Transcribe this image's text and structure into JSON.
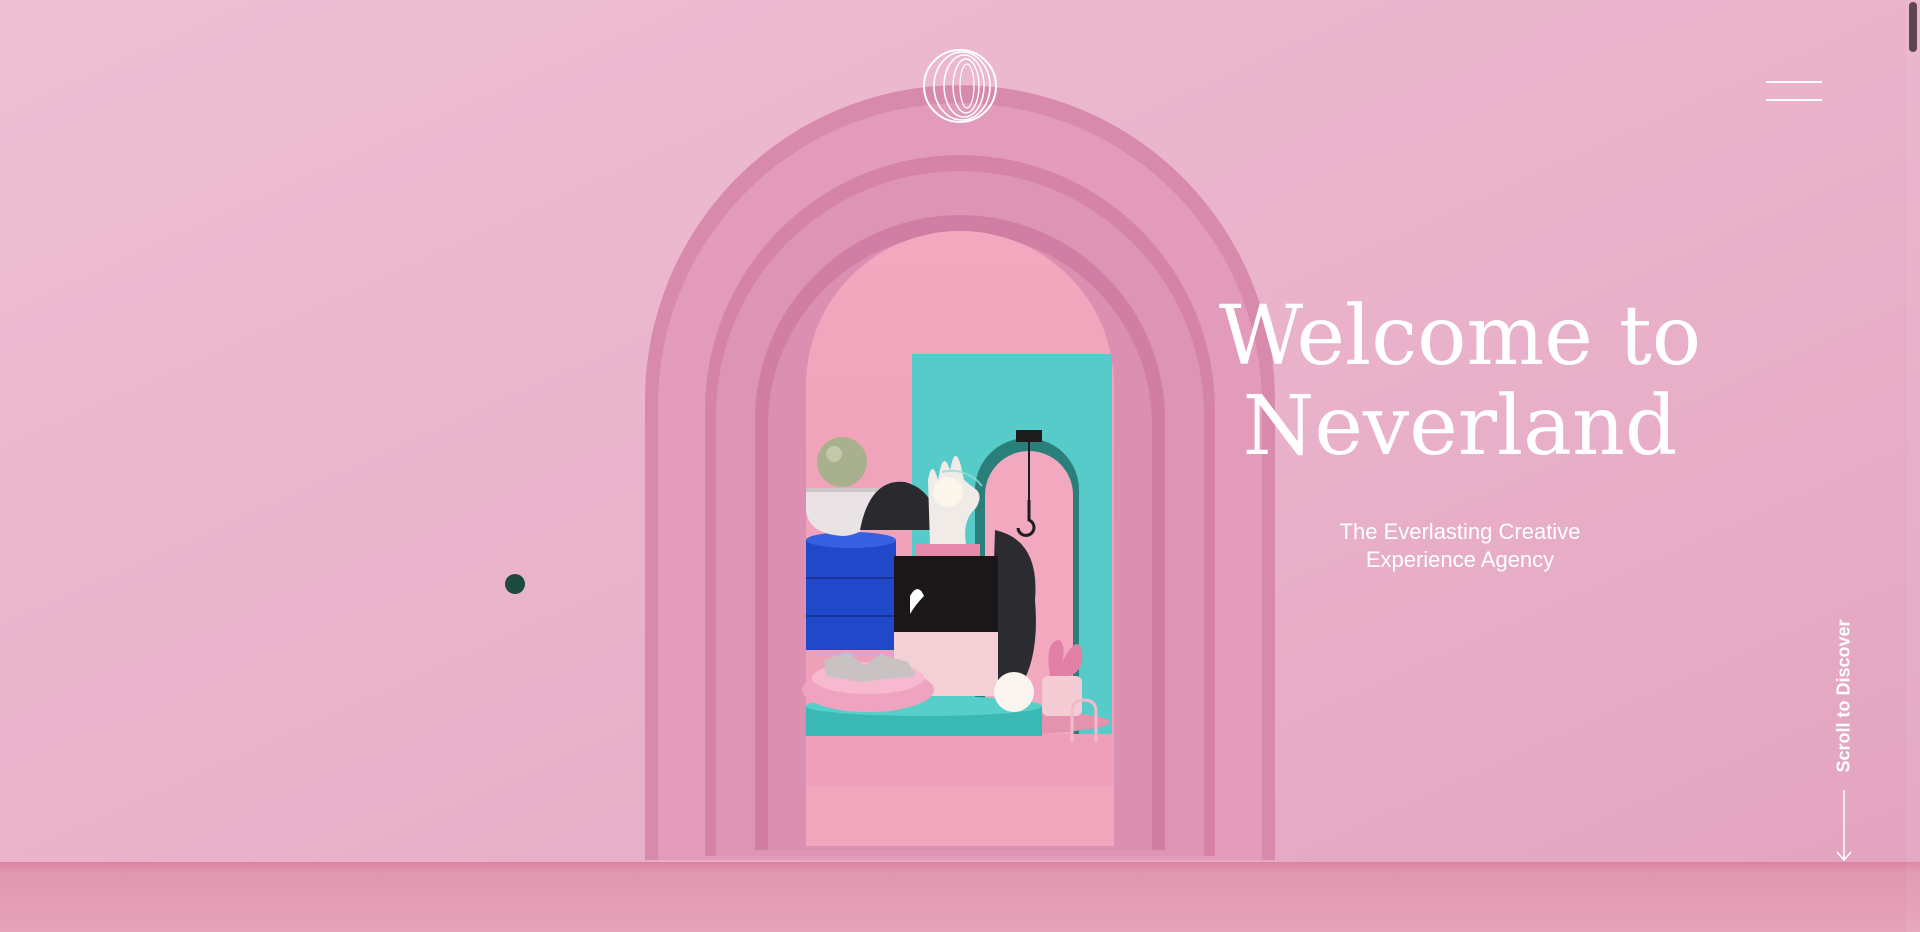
{
  "header": {
    "logo_icon": "concentric-rings-logo",
    "menu_icon": "hamburger-menu-icon"
  },
  "hero": {
    "title_line_1": "Welcome to",
    "title_line_2": "Neverland",
    "tagline_line_1": "The Everlasting Creative",
    "tagline_line_2": "Experience Agency",
    "scroll_label": "Scroll to Discover",
    "scroll_icon": "arrow-down-icon"
  },
  "colors": {
    "background": "#e8afc8",
    "arch": "#dc8fb3",
    "teal": "#4fcac7",
    "dot": "#1d4a3e",
    "text": "#ffffff"
  }
}
